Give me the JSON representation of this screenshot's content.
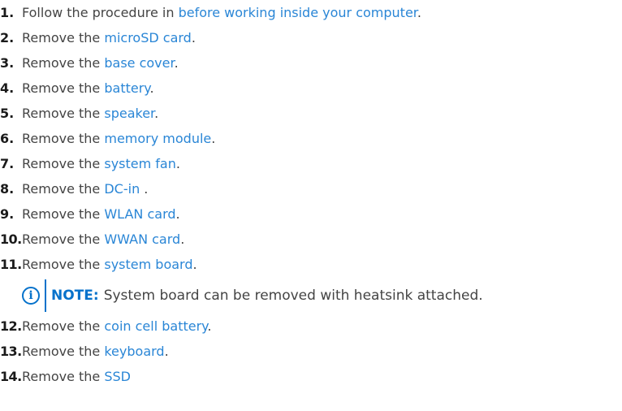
{
  "steps_upper": [
    {
      "num": "1.",
      "text": "Follow the procedure in ",
      "link": "before working inside your computer",
      "suffix": "."
    },
    {
      "num": "2.",
      "text": "Remove the ",
      "link": "microSD card",
      "suffix": "."
    },
    {
      "num": "3.",
      "text": "Remove the ",
      "link": "base cover",
      "suffix": "."
    },
    {
      "num": "4.",
      "text": "Remove the ",
      "link": "battery",
      "suffix": "."
    },
    {
      "num": "5.",
      "text": "Remove the ",
      "link": "speaker",
      "suffix": "."
    },
    {
      "num": "6.",
      "text": "Remove the ",
      "link": "memory module",
      "suffix": "."
    },
    {
      "num": "7.",
      "text": "Remove the ",
      "link": "system fan",
      "suffix": "."
    },
    {
      "num": "8.",
      "text": "Remove the ",
      "link": "DC-in ",
      "suffix": "."
    },
    {
      "num": "9.",
      "text": "Remove the ",
      "link": "WLAN card",
      "suffix": "."
    },
    {
      "num": "10.",
      "text": "Remove the ",
      "link": "WWAN card",
      "suffix": "."
    },
    {
      "num": "11.",
      "text": "Remove the ",
      "link": "system board",
      "suffix": "."
    }
  ],
  "note": {
    "icon": "info-icon",
    "icon_glyph": "i",
    "label": "NOTE:",
    "text": "System board can be removed with heatsink attached."
  },
  "steps_lower": [
    {
      "num": "12.",
      "text": "Remove the ",
      "link": "coin cell battery",
      "suffix": "."
    },
    {
      "num": "13.",
      "text": "Remove the ",
      "link": "keyboard",
      "suffix": "."
    },
    {
      "num": "14.",
      "text": "Remove the ",
      "link": "SSD",
      "suffix": ""
    }
  ],
  "colors": {
    "link": "#2a86d6",
    "text": "#444444",
    "number": "#1a1a1a",
    "note_accent": "#0672cb"
  }
}
